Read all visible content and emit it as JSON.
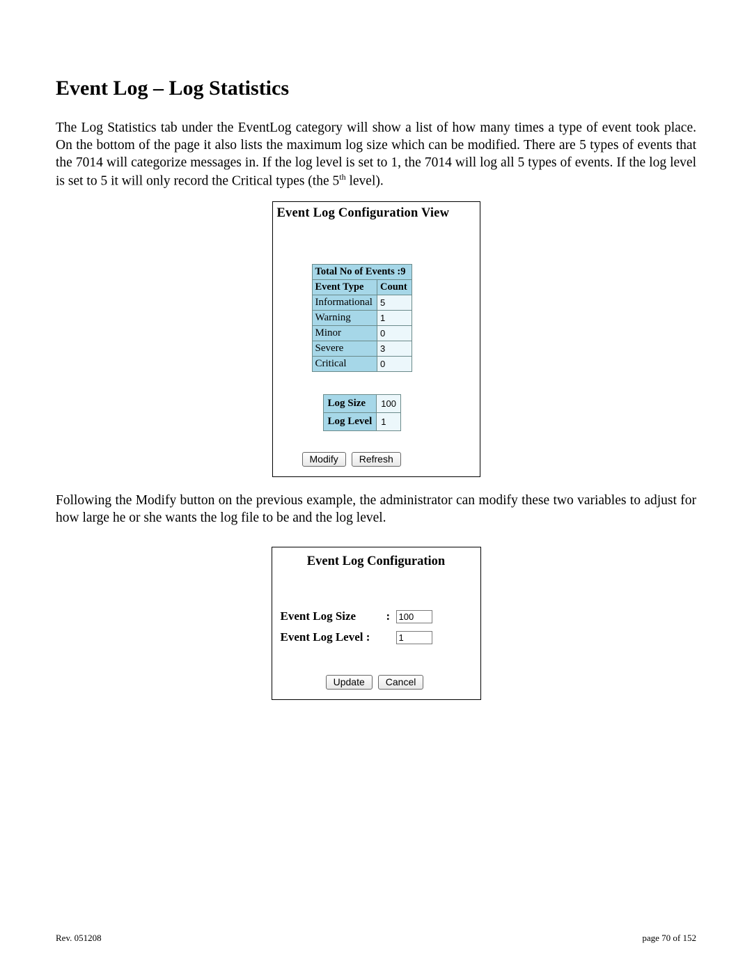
{
  "heading": "Event Log – Log Statistics",
  "paragraph1": "The Log Statistics tab under the EventLog category will show a list of how many times a type of event took place.  On the bottom of the page it also lists the maximum log size which can be modified.  There are 5 types of events that the 7014 will categorize messages in.  If the log level is set to 1, the 7014 will log all 5 types of events.  If the log level is set to 5 it will only record the Critical types (the 5",
  "paragraph1_sup": "th",
  "paragraph1_tail": " level).",
  "panel1": {
    "title": "Event Log Configuration View",
    "total_label": "Total No of Events :9",
    "columns": {
      "c1": "Event Type",
      "c2": "Count"
    },
    "rows": [
      {
        "type": "Informational",
        "count": "5"
      },
      {
        "type": "Warning",
        "count": "1"
      },
      {
        "type": "Minor",
        "count": "0"
      },
      {
        "type": "Severe",
        "count": "3"
      },
      {
        "type": "Critical",
        "count": "0"
      }
    ],
    "log_size_label": "Log Size",
    "log_size_value": "100",
    "log_level_label": "Log Level",
    "log_level_value": "1",
    "modify_btn": "Modify",
    "refresh_btn": "Refresh"
  },
  "paragraph2": "Following the Modify button on the previous example, the administrator can modify these two variables to adjust for how large he or she wants the log file to be and the log level.",
  "panel2": {
    "title": "Event Log Configuration",
    "size_label": "Event Log Size",
    "size_value": "100",
    "level_label": "Event Log Level :",
    "level_value": "1",
    "update_btn": "Update",
    "cancel_btn": "Cancel"
  },
  "footer": {
    "left": "Rev.  051208",
    "right": "page 70 of 152"
  }
}
